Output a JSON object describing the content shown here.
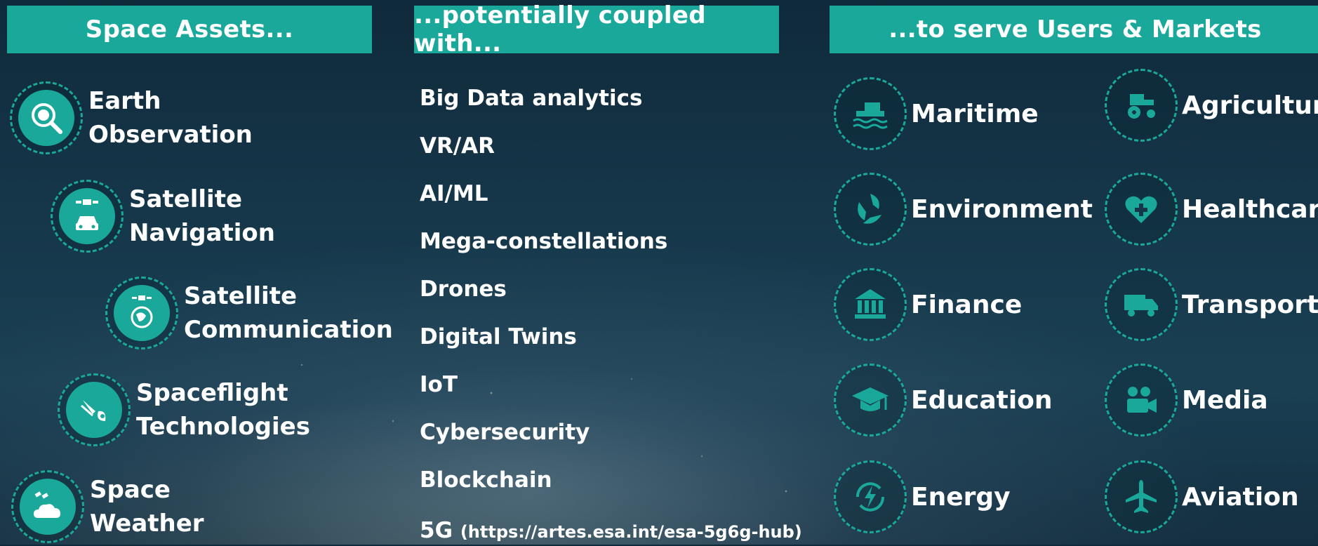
{
  "headers": {
    "assets": "Space Assets...",
    "coupled": "...potentially coupled with...",
    "markets": "...to serve Users & Markets"
  },
  "assets": [
    {
      "line1": "Earth",
      "line2": "Observation",
      "icon": "earth-magnifier-icon"
    },
    {
      "line1": "Satellite",
      "line2": "Navigation",
      "icon": "satellite-car-icon"
    },
    {
      "line1": "Satellite",
      "line2": "Communication",
      "icon": "satellite-globe-icon"
    },
    {
      "line1": "Spaceflight",
      "line2": "Technologies",
      "icon": "rocket-icon"
    },
    {
      "line1": "Space",
      "line2": "Weather",
      "icon": "satellite-cloud-icon"
    }
  ],
  "technologies": [
    "Big Data analytics",
    "VR/AR",
    "AI/ML",
    "Mega-constellations",
    "Drones",
    "Digital Twins",
    "IoT",
    "Cybersecurity",
    "Blockchain"
  ],
  "tech_last": {
    "label": "5G",
    "link": "(https://artes.esa.int/esa-5g6g-hub)"
  },
  "markets": [
    {
      "label": "Maritime",
      "icon": "ship-icon"
    },
    {
      "label": "Agriculture",
      "icon": "tractor-icon"
    },
    {
      "label": "Environment",
      "icon": "recycle-leaf-icon"
    },
    {
      "label": "Healthcare",
      "icon": "heart-plus-icon"
    },
    {
      "label": "Finance",
      "icon": "bank-icon"
    },
    {
      "label": "Transport",
      "icon": "truck-icon"
    },
    {
      "label": "Education",
      "icon": "graduation-cap-icon"
    },
    {
      "label": "Media",
      "icon": "video-camera-icon"
    },
    {
      "label": "Energy",
      "icon": "energy-cycle-icon"
    },
    {
      "label": "Aviation",
      "icon": "airplane-icon"
    }
  ],
  "colors": {
    "accent": "#1aa89a",
    "background": "#16374a",
    "text": "#ffffff"
  }
}
